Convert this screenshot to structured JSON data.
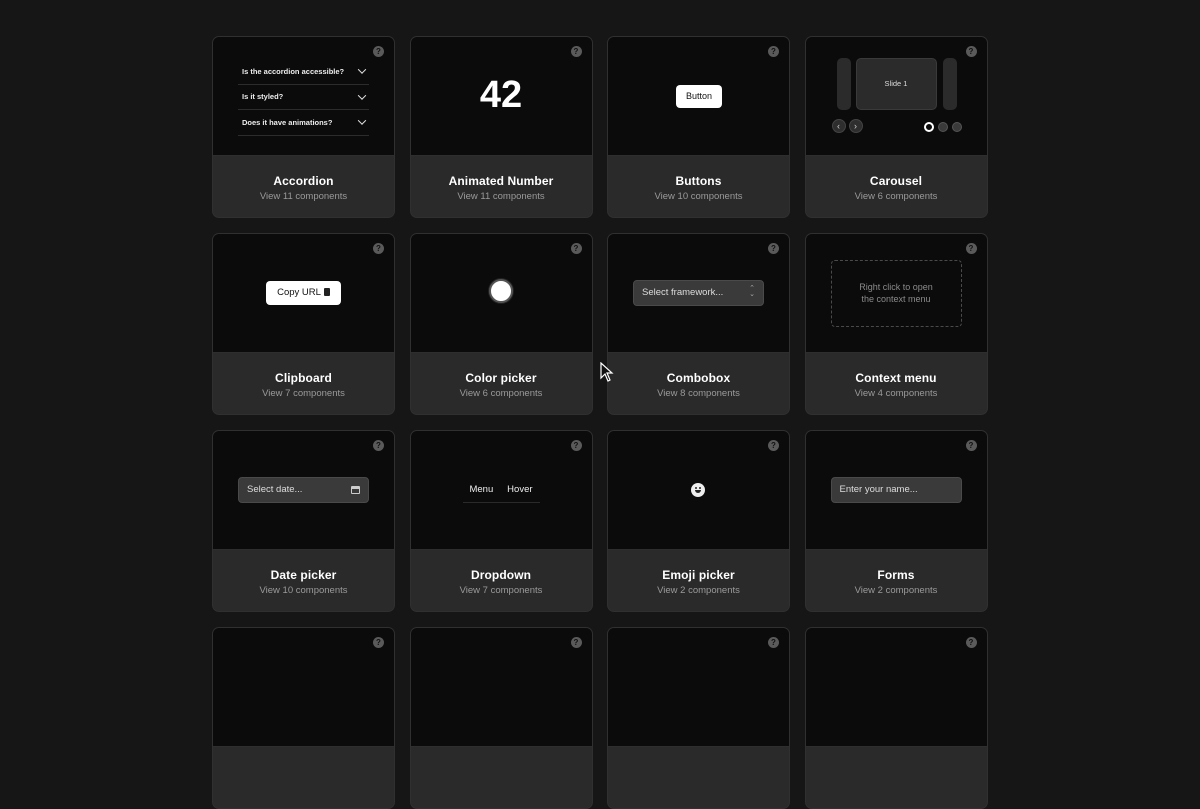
{
  "cards": [
    {
      "title": "Accordion",
      "subtitle": "View 11 components",
      "demo": {
        "items": [
          "Is the accordion accessible?",
          "Is it styled?",
          "Does it have animations?"
        ]
      }
    },
    {
      "title": "Animated Number",
      "subtitle": "View 11 components",
      "demo": {
        "value": "42"
      }
    },
    {
      "title": "Buttons",
      "subtitle": "View 10 components",
      "demo": {
        "label": "Button"
      }
    },
    {
      "title": "Carousel",
      "subtitle": "View 6 components",
      "demo": {
        "slide": "Slide 1",
        "prev": "‹",
        "next": "›"
      }
    },
    {
      "title": "Clipboard",
      "subtitle": "View 7 components",
      "demo": {
        "label": "Copy URL"
      }
    },
    {
      "title": "Color picker",
      "subtitle": "View 6 components",
      "demo": {
        "color": "#ffffff"
      }
    },
    {
      "title": "Combobox",
      "subtitle": "View 8 components",
      "demo": {
        "placeholder": "Select framework..."
      }
    },
    {
      "title": "Context menu",
      "subtitle": "View 4 components",
      "demo": {
        "line1": "Right click to open",
        "line2": "the context menu"
      }
    },
    {
      "title": "Date picker",
      "subtitle": "View 10 components",
      "demo": {
        "placeholder": "Select date..."
      }
    },
    {
      "title": "Dropdown",
      "subtitle": "View 7 components",
      "demo": {
        "items": [
          "Menu",
          "Hover"
        ]
      }
    },
    {
      "title": "Emoji picker",
      "subtitle": "View 2 components",
      "demo": {
        "icon": "smiley-emoji-icon"
      }
    },
    {
      "title": "Forms",
      "subtitle": "View 2 components",
      "demo": {
        "placeholder": "Enter your name..."
      }
    }
  ],
  "help_glyph": "?",
  "colors": {
    "background": "#161616",
    "preview": "#0b0b0b",
    "card_footer": "#2a2a2a",
    "subtitle": "#9a9a9a"
  }
}
